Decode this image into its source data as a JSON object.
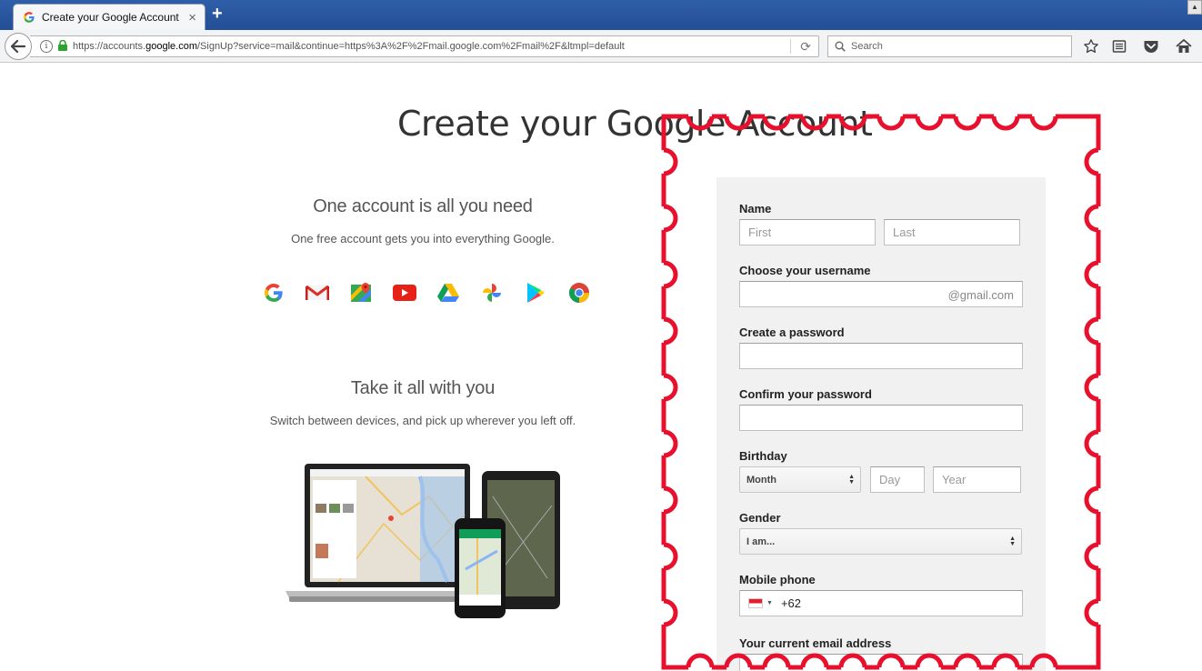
{
  "browser": {
    "tab_title": "Create your Google Account",
    "tab_close": "×",
    "new_tab": "+",
    "url_prefix": "https://accounts.",
    "url_host": "google.com",
    "url_suffix": "/SignUp?service=mail&continue=https%3A%2F%2Fmail.google.com%2Fmail%2F&ltmpl=default",
    "search_placeholder": "Search",
    "icons": [
      "back-arrow-icon",
      "info-icon",
      "lock-icon",
      "reload-icon",
      "search-icon",
      "bookmark-star-icon",
      "reading-list-icon",
      "pocket-icon",
      "home-icon"
    ]
  },
  "page": {
    "title": "Create your Google Account",
    "section1": {
      "heading": "One account is all you need",
      "text": "One free account gets you into everything Google."
    },
    "apps": [
      "google-icon",
      "gmail-icon",
      "maps-icon",
      "youtube-icon",
      "drive-icon",
      "photos-icon",
      "play-icon",
      "chrome-icon"
    ],
    "section2": {
      "heading": "Take it all with you",
      "text": "Switch between devices, and pick up wherever you left off."
    }
  },
  "form": {
    "name_label": "Name",
    "first_placeholder": "First",
    "last_placeholder": "Last",
    "username_label": "Choose your username",
    "username_suffix": "@gmail.com",
    "password_label": "Create a password",
    "confirm_label": "Confirm your password",
    "birthday_label": "Birthday",
    "month_value": "Month",
    "day_placeholder": "Day",
    "year_placeholder": "Year",
    "gender_label": "Gender",
    "gender_value": "I am...",
    "phone_label": "Mobile phone",
    "phone_code": "+62",
    "email_label": "Your current email address"
  },
  "colors": {
    "stamp_red": "#e8112d",
    "card_bg": "#f1f1f1",
    "titlebar": "#2a5599"
  }
}
